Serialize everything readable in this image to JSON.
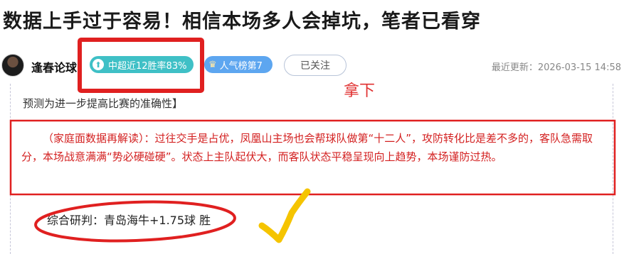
{
  "article": {
    "title": "数据上手过于容易！相信本场多人会掉坑，笔者已看穿",
    "author": "逢春论球",
    "badges": {
      "hit_rate": "中超近12胜率83%",
      "popularity": "人气榜第7"
    },
    "follow_label": "已关注",
    "updated": "最近更新：2026-03-15 14:58",
    "paragraph_prev": "预测为进一步提高比赛的准确性】",
    "paragraph_red": "（家庭面数据再解读）：过往交手是占优，凤凰山主场也会帮球队做第“十二人”，攻防转化比是差不多的，客队急需取分，本场战意满满“势必硬碰硬”。状态上主队起伏大，而客队状态平稳呈现向上趋势，本场谨防过热。",
    "verdict": "综合研判：青岛海牛+1.75球 胜"
  },
  "annotation": {
    "label": "拿下",
    "color": "#e03030",
    "check_color": "#f5c400"
  }
}
